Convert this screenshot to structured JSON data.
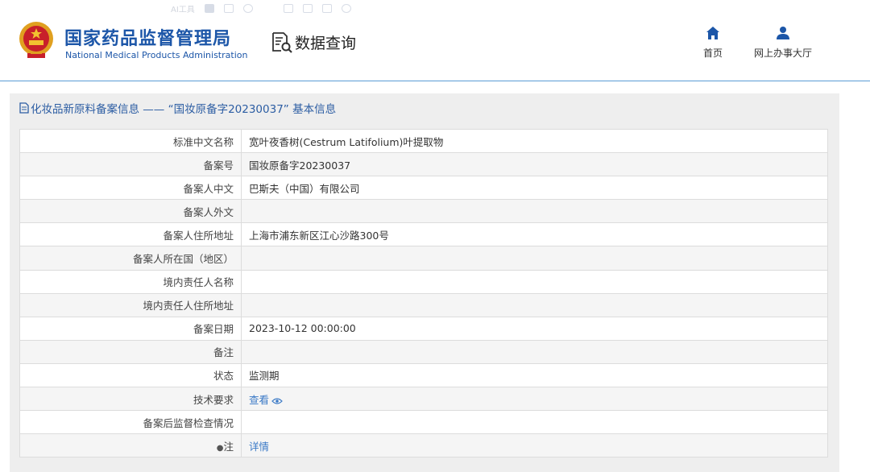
{
  "toolbar": {
    "ai_label": "AI工具"
  },
  "header": {
    "brand_cn": "国家药品监督管理局",
    "brand_en": "National Medical Products Administration",
    "query_title": "数据查询",
    "nav": {
      "home": "首页",
      "hall": "网上办事大厅"
    }
  },
  "panel": {
    "title": "化妆品新原料备案信息 —— “国妆原备字20230037” 基本信息"
  },
  "rows": [
    {
      "label": "标准中文名称",
      "value": "宽叶夜香树(Cestrum Latifolium)叶提取物"
    },
    {
      "label": "备案号",
      "value": "国妆原备字20230037"
    },
    {
      "label": "备案人中文",
      "value": "巴斯夫（中国）有限公司"
    },
    {
      "label": "备案人外文",
      "value": ""
    },
    {
      "label": "备案人住所地址",
      "value": "上海市浦东新区江心沙路300号"
    },
    {
      "label": "备案人所在国（地区）",
      "value": ""
    },
    {
      "label": "境内责任人名称",
      "value": ""
    },
    {
      "label": "境内责任人住所地址",
      "value": ""
    },
    {
      "label": "备案日期",
      "value": "2023-10-12 00:00:00"
    },
    {
      "label": "备注",
      "value": ""
    },
    {
      "label": "状态",
      "value": "监测期"
    },
    {
      "label": "技术要求",
      "link": "查看"
    },
    {
      "label": "备案后监督检查情况",
      "value": ""
    },
    {
      "label": "注",
      "link": "详情"
    }
  ],
  "colors": {
    "brand": "#1c56a8",
    "link": "#3a79c6",
    "panel_bg": "#eeeeee",
    "header_line": "#5b9bd5"
  }
}
